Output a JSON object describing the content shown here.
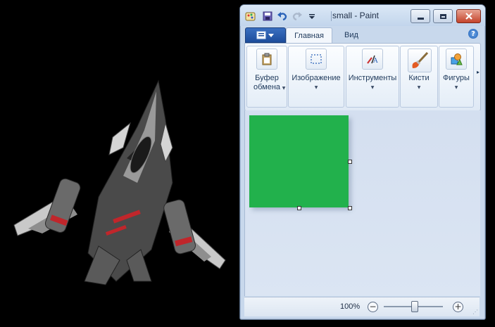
{
  "window": {
    "title": "small - Paint",
    "minimize_icon": "minimize-icon",
    "maximize_icon": "maximize-icon",
    "close_icon": "close-icon"
  },
  "quick_access": {
    "icons": [
      "paint-app-icon",
      "save-icon",
      "undo-icon",
      "redo-icon",
      "customize-dropdown-icon"
    ]
  },
  "tabs": {
    "file_icon": "file-menu-icon",
    "home": "Главная",
    "view": "Вид",
    "help_icon": "help-icon",
    "help_glyph": "?"
  },
  "ribbon": {
    "groups": [
      {
        "line1": "Буфер",
        "line2": "обмена",
        "icon": "clipboard-icon"
      },
      {
        "line1": "Изображение",
        "line2": "",
        "icon": "select-icon"
      },
      {
        "line1": "Инструменты",
        "line2": "",
        "icon": "tools-icon"
      },
      {
        "line1": "Кисти",
        "line2": "",
        "icon": "brush-icon"
      },
      {
        "line1": "Фигуры",
        "line2": "",
        "icon": "shapes-icon"
      }
    ],
    "scroll_glyph": "▸"
  },
  "canvas": {
    "fill_color": "#22b14c"
  },
  "status": {
    "zoom": "100%",
    "zoom_out": "−",
    "zoom_in": "+"
  },
  "colors": {
    "background": "#000000",
    "accent": "#1d4d9b"
  }
}
